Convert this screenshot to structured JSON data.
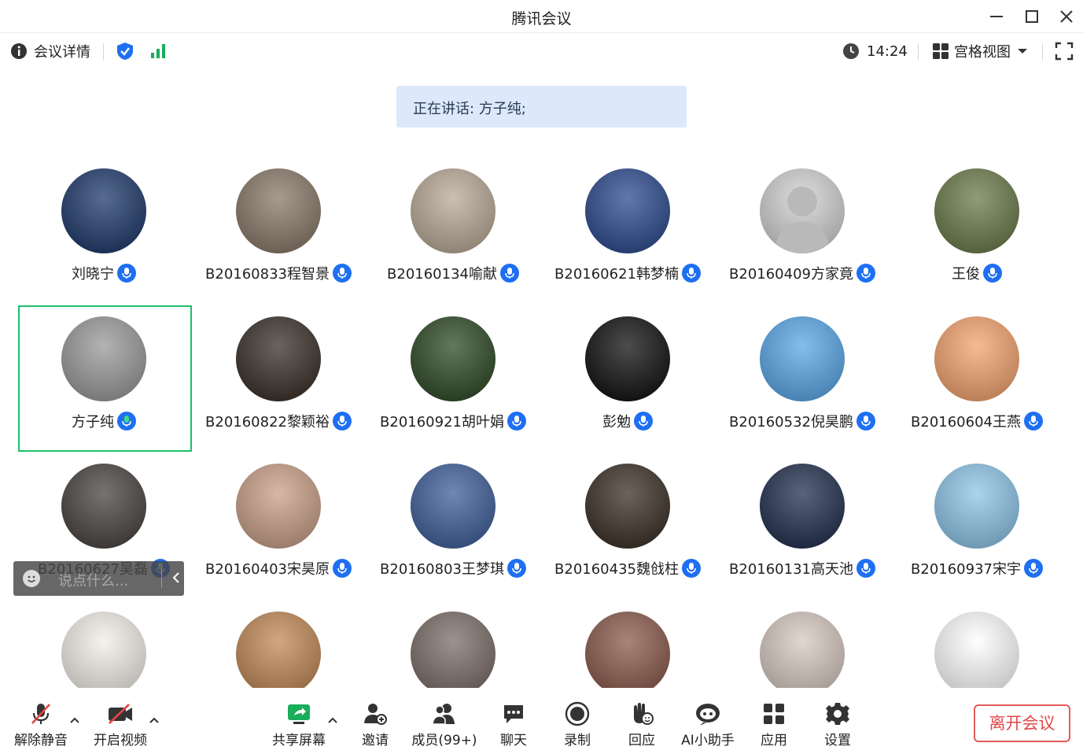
{
  "window": {
    "title": "腾讯会议",
    "controls": [
      "minimize-icon",
      "maximize-icon",
      "close-icon"
    ]
  },
  "toolbar": {
    "meeting_info_label": "会议详情",
    "time": "14:24",
    "view_label": "宫格视图"
  },
  "speaking": {
    "text": "正在讲话: 方子纯;"
  },
  "participants": [
    {
      "name": "刘晓宁",
      "avatar_color": "#1f3a6b",
      "selected": false
    },
    {
      "name": "B20160833程智景",
      "avatar_color": "#8a7a6a",
      "selected": false
    },
    {
      "name": "B20160134喻献",
      "avatar_color": "#b9aa96",
      "selected": false
    },
    {
      "name": "B20160621韩梦楠",
      "avatar_color": "#2d4b8e",
      "selected": false
    },
    {
      "name": "B20160409方家竟",
      "avatar_color": "#d2d2d2",
      "selected": false
    },
    {
      "name": "王俊",
      "avatar_color": "#6b7a4a",
      "selected": false
    },
    {
      "name": "方子纯",
      "avatar_color": "#9a9a9a",
      "selected": true
    },
    {
      "name": "B20160822黎颖裕",
      "avatar_color": "#3a3028",
      "selected": false
    },
    {
      "name": "B20160921胡叶娟",
      "avatar_color": "#2e4a25",
      "selected": false
    },
    {
      "name": "彭勉",
      "avatar_color": "#111111",
      "selected": false
    },
    {
      "name": "B20160532倪昊鹏",
      "avatar_color": "#5aa8e8",
      "selected": false
    },
    {
      "name": "B20160604王燕",
      "avatar_color": "#f4a470",
      "selected": false
    },
    {
      "name": "B20160627吴磊",
      "avatar_color": "#4a4440",
      "selected": false
    },
    {
      "name": "B20160403宋昊原",
      "avatar_color": "#c9a088",
      "selected": false
    },
    {
      "name": "B20160803王梦琪",
      "avatar_color": "#3f5f99",
      "selected": false
    },
    {
      "name": "B20160435魏戗柱",
      "avatar_color": "#3b3026",
      "selected": false
    },
    {
      "name": "B20160131高天池",
      "avatar_color": "#22304f",
      "selected": false
    },
    {
      "name": "B20160937宋宇",
      "avatar_color": "#8ec6e8",
      "selected": false
    },
    {
      "name": "",
      "avatar_color": "#f3efe8",
      "selected": false
    },
    {
      "name": "",
      "avatar_color": "#c28a58",
      "selected": false
    },
    {
      "name": "",
      "avatar_color": "#7c6e68",
      "selected": false
    },
    {
      "name": "",
      "avatar_color": "#8a5a4c",
      "selected": false
    },
    {
      "name": "",
      "avatar_color": "#d8c8c0",
      "selected": false
    },
    {
      "name": "",
      "avatar_color": "#ffffff",
      "selected": false
    }
  ],
  "chat_popup": {
    "placeholder": "说点什么..."
  },
  "bottombar": {
    "unmute": "解除静音",
    "start_video": "开启视频",
    "share_screen": "共享屏幕",
    "invite": "邀请",
    "members": "成员(99+)",
    "chat": "聊天",
    "record": "录制",
    "reactions": "回应",
    "ai_assistant": "AI小助手",
    "apps": "应用",
    "settings": "设置",
    "leave": "离开会议"
  },
  "colors": {
    "accent_blue": "#1e6ff2",
    "selected_border": "#1cbf6b",
    "leave_red": "#e04848",
    "speaking_bg": "#dde9fb",
    "signal_green": "#1aad5a"
  }
}
